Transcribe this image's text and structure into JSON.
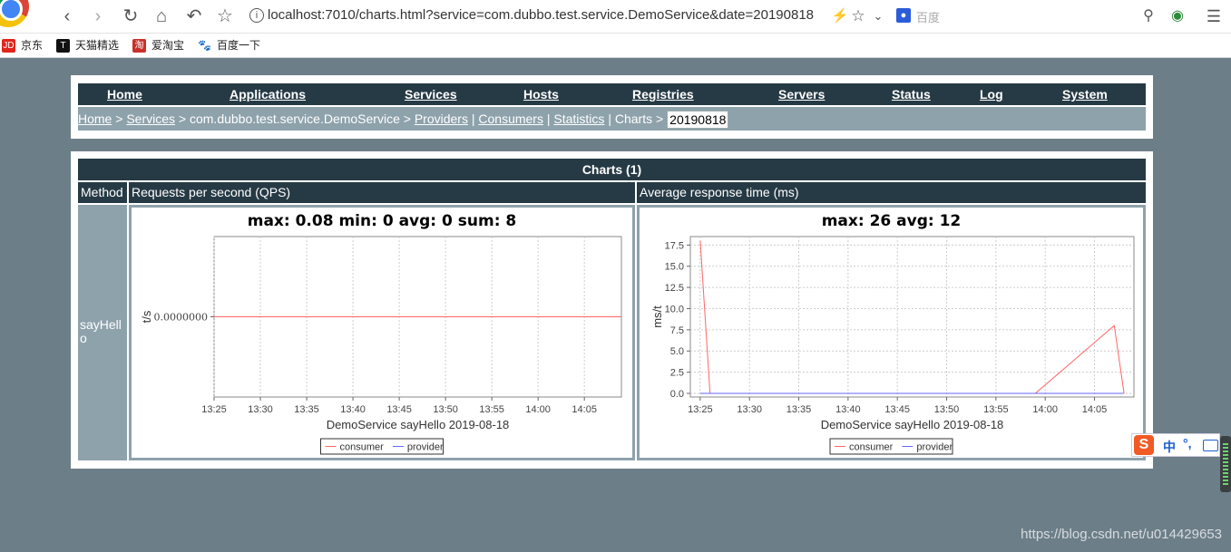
{
  "browser": {
    "url": "localhost:7010/charts.html?service=com.dubbo.test.service.DemoService&date=20190818",
    "search_placeholder": "百度",
    "bookmarks": [
      {
        "icon_text": "JD",
        "label": "京东",
        "color": "#e1251b"
      },
      {
        "icon_text": "T",
        "label": "天猫精选",
        "color": "#d00000"
      },
      {
        "icon_text": "淘",
        "label": "爱淘宝",
        "color": "#e02020"
      },
      {
        "icon_text": "🐾",
        "label": "百度一下",
        "color": "#2f6fe0"
      }
    ]
  },
  "nav": {
    "items": [
      "Home",
      "Applications",
      "Services",
      "Hosts",
      "Registries",
      "Servers",
      "Status",
      "Log",
      "System"
    ]
  },
  "breadcrumb": {
    "home": "Home",
    "services": "Services",
    "service": "com.dubbo.test.service.DemoService",
    "providers": "Providers",
    "consumers": "Consumers",
    "statistics": "Statistics",
    "charts": "Charts",
    "date": "20190818",
    "gt": ">",
    "pipe": "|"
  },
  "charts_table": {
    "title": "Charts (1)",
    "headers": {
      "method": "Method",
      "qps": "Requests per second (QPS)",
      "rt": "Average response time (ms)"
    },
    "method_name": "sayHello"
  },
  "chart_data": [
    {
      "type": "line",
      "title": "max: 0.08 min: 0 avg: 0 sum: 8",
      "xlabel": "DemoService  sayHello  2019-08-18",
      "ylabel": "t/s",
      "x_ticks": [
        "13:25",
        "13:30",
        "13:35",
        "13:40",
        "13:45",
        "13:50",
        "13:55",
        "14:00",
        "14:05"
      ],
      "y_ticks": [
        "0.0000000"
      ],
      "xlim": [
        "13:25",
        "14:09"
      ],
      "grid": true,
      "legend": "bottom-center",
      "series": [
        {
          "name": "consumer",
          "color": "#ff6666",
          "points": [
            [
              "13:25",
              0
            ],
            [
              "14:09",
              0
            ]
          ]
        },
        {
          "name": "provider",
          "color": "#6666ff",
          "points": []
        }
      ]
    },
    {
      "type": "line",
      "title": "max: 26 avg: 12",
      "xlabel": "DemoService  sayHello  2019-08-18",
      "ylabel": "ms/t",
      "x_ticks": [
        "13:25",
        "13:30",
        "13:35",
        "13:40",
        "13:45",
        "13:50",
        "13:55",
        "14:00",
        "14:05"
      ],
      "y_ticks": [
        "0.0",
        "2.5",
        "5.0",
        "7.5",
        "10.0",
        "12.5",
        "15.0",
        "17.5"
      ],
      "xlim": [
        "13:24",
        "14:09"
      ],
      "ylim": [
        0,
        18.5
      ],
      "grid": true,
      "legend": "bottom-center",
      "series": [
        {
          "name": "consumer",
          "color": "#ff6666",
          "points": [
            [
              "13:25",
              18
            ],
            [
              "13:26",
              0
            ],
            [
              "13:59",
              0
            ],
            [
              "14:07",
              8
            ],
            [
              "14:08",
              0
            ]
          ]
        },
        {
          "name": "provider",
          "color": "#6666ff",
          "points": [
            [
              "13:25",
              0
            ],
            [
              "14:08",
              0
            ]
          ]
        }
      ]
    }
  ],
  "ime": {
    "logo": "S",
    "lang": "中",
    "punct": "°,"
  },
  "watermark": "https://blog.csdn.net/u014429653"
}
